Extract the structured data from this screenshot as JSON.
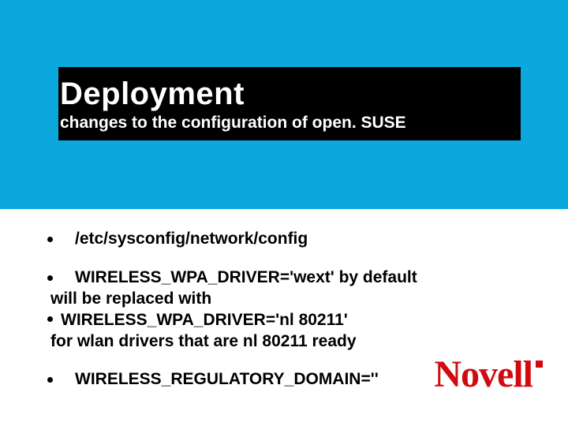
{
  "header": {
    "title": "Deployment",
    "subtitle": "changes to the configuration of open. SUSE"
  },
  "body": {
    "b1": "/etc/sysconfig/network/config",
    "b2": "WIRELESS_WPA_DRIVER='wext' by default",
    "c2a": "will be replaced with",
    "b3": "WIRELESS_WPA_DRIVER='nl 80211'",
    "c3a": "for wlan drivers that are nl 80211 ready",
    "b4": "WIRELESS_REGULATORY_DOMAIN=''"
  },
  "logo": {
    "text": "Novell"
  }
}
